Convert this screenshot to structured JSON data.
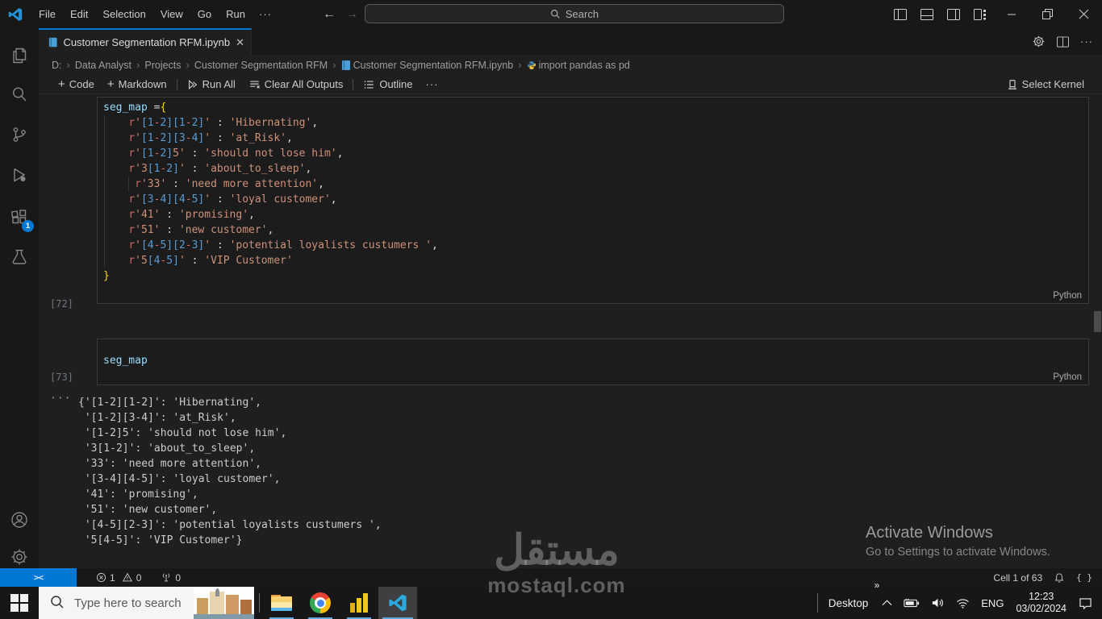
{
  "icons": {
    "ellipsis": "···",
    "back": "←",
    "forward": "→",
    "search_glyph": "⌕",
    "chevron": "›",
    "close": "✕",
    "plus": "+",
    "guillemet": "»",
    "remote": "><",
    "braces": "{ }"
  },
  "titlebar": {
    "menus": [
      "File",
      "Edit",
      "Selection",
      "View",
      "Go",
      "Run"
    ],
    "search_placeholder": "Search"
  },
  "tab": {
    "title": "Customer Segmentation RFM.ipynb"
  },
  "breadcrumbs": {
    "items": [
      "D:",
      "Data Analyst",
      "Projects",
      "Customer Segmentation RFM",
      "Customer Segmentation RFM.ipynb",
      "import pandas as pd"
    ]
  },
  "notebook_toolbar": {
    "code": "Code",
    "markdown": "Markdown",
    "run_all": "Run All",
    "clear_all": "Clear All Outputs",
    "outline": "Outline",
    "select_kernel": "Select Kernel"
  },
  "cells": [
    {
      "execution_count": "[72]",
      "language": "Python",
      "lines": [
        [
          [
            "k",
            "seg_map"
          ],
          [
            "d",
            " ="
          ],
          [
            "y",
            "{"
          ]
        ],
        [
          [
            "d",
            "    "
          ],
          [
            "r",
            "r"
          ],
          [
            "s",
            "'"
          ],
          [
            "c",
            "[1"
          ],
          [
            "r",
            "-"
          ],
          [
            "c",
            "2]"
          ],
          [
            "c",
            "[1"
          ],
          [
            "r",
            "-"
          ],
          [
            "c",
            "2]"
          ],
          [
            "s",
            "'"
          ],
          [
            "d",
            " : "
          ],
          [
            "s",
            "'Hibernating'"
          ],
          [
            "d",
            ","
          ]
        ],
        [
          [
            "d",
            "    "
          ],
          [
            "r",
            "r"
          ],
          [
            "s",
            "'"
          ],
          [
            "c",
            "[1"
          ],
          [
            "r",
            "-"
          ],
          [
            "c",
            "2]"
          ],
          [
            "c",
            "[3"
          ],
          [
            "r",
            "-"
          ],
          [
            "c",
            "4]"
          ],
          [
            "s",
            "'"
          ],
          [
            "d",
            " : "
          ],
          [
            "s",
            "'at_Risk'"
          ],
          [
            "d",
            ","
          ]
        ],
        [
          [
            "d",
            "    "
          ],
          [
            "r",
            "r"
          ],
          [
            "s",
            "'"
          ],
          [
            "c",
            "[1"
          ],
          [
            "r",
            "-"
          ],
          [
            "c",
            "2]"
          ],
          [
            "s",
            "5'"
          ],
          [
            "d",
            " : "
          ],
          [
            "s",
            "'should not lose him'"
          ],
          [
            "d",
            ","
          ]
        ],
        [
          [
            "d",
            "    "
          ],
          [
            "r",
            "r"
          ],
          [
            "s",
            "'3"
          ],
          [
            "c",
            "[1"
          ],
          [
            "r",
            "-"
          ],
          [
            "c",
            "2]"
          ],
          [
            "s",
            "'"
          ],
          [
            "d",
            " : "
          ],
          [
            "s",
            "'about_to_sleep'"
          ],
          [
            "d",
            ","
          ]
        ],
        [
          [
            "d",
            "     "
          ],
          [
            "r",
            "r"
          ],
          [
            "s",
            "'33'"
          ],
          [
            "d",
            " : "
          ],
          [
            "s",
            "'need more attention'"
          ],
          [
            "d",
            ","
          ]
        ],
        [
          [
            "d",
            "    "
          ],
          [
            "r",
            "r"
          ],
          [
            "s",
            "'"
          ],
          [
            "c",
            "[3"
          ],
          [
            "r",
            "-"
          ],
          [
            "c",
            "4]"
          ],
          [
            "c",
            "[4"
          ],
          [
            "r",
            "-"
          ],
          [
            "c",
            "5]"
          ],
          [
            "s",
            "'"
          ],
          [
            "d",
            " : "
          ],
          [
            "s",
            "'loyal customer'"
          ],
          [
            "d",
            ","
          ]
        ],
        [
          [
            "d",
            "    "
          ],
          [
            "r",
            "r"
          ],
          [
            "s",
            "'41'"
          ],
          [
            "d",
            " : "
          ],
          [
            "s",
            "'promising'"
          ],
          [
            "d",
            ","
          ]
        ],
        [
          [
            "d",
            "    "
          ],
          [
            "r",
            "r"
          ],
          [
            "s",
            "'51'"
          ],
          [
            "d",
            " : "
          ],
          [
            "s",
            "'new customer'"
          ],
          [
            "d",
            ","
          ]
        ],
        [
          [
            "d",
            "    "
          ],
          [
            "r",
            "r"
          ],
          [
            "s",
            "'"
          ],
          [
            "c",
            "[4"
          ],
          [
            "r",
            "-"
          ],
          [
            "c",
            "5]"
          ],
          [
            "c",
            "[2"
          ],
          [
            "r",
            "-"
          ],
          [
            "c",
            "3]"
          ],
          [
            "s",
            "'"
          ],
          [
            "d",
            " : "
          ],
          [
            "s",
            "'potential loyalists custumers '"
          ],
          [
            "d",
            ","
          ]
        ],
        [
          [
            "d",
            "    "
          ],
          [
            "r",
            "r"
          ],
          [
            "s",
            "'5"
          ],
          [
            "c",
            "[4"
          ],
          [
            "r",
            "-"
          ],
          [
            "c",
            "5]"
          ],
          [
            "s",
            "'"
          ],
          [
            "d",
            " : "
          ],
          [
            "s",
            "'VIP Customer'"
          ]
        ],
        [
          [
            "y",
            "}"
          ]
        ]
      ]
    },
    {
      "execution_count": "[73]",
      "language": "Python",
      "lines": [
        [
          [
            "k",
            "seg_map"
          ]
        ]
      ]
    }
  ],
  "output": {
    "gutter": "···",
    "lines": [
      "{'[1-2][1-2]': 'Hibernating',",
      " '[1-2][3-4]': 'at_Risk',",
      " '[1-2]5': 'should not lose him',",
      " '3[1-2]': 'about_to_sleep',",
      " '33': 'need more attention',",
      " '[3-4][4-5]': 'loyal customer',",
      " '41': 'promising',",
      " '51': 'new customer',",
      " '[4-5][2-3]': 'potential loyalists custumers ',",
      " '5[4-5]': 'VIP Customer'}"
    ]
  },
  "activitybar": {
    "extensions_badge": "1"
  },
  "statusbar": {
    "errors": "1",
    "warnings": "0",
    "ports": "0",
    "cell_indicator": "Cell 1 of 63"
  },
  "taskbar": {
    "search_placeholder": "Type here to search",
    "desktop_label": "Desktop",
    "language": "ENG",
    "time": "12:23",
    "date": "03/02/2024"
  },
  "watermarks": {
    "activate_title": "Activate Windows",
    "activate_subtitle": "Go to Settings to activate Windows.",
    "brand_arabic": "مستقل",
    "brand_domain": "mostaql.com"
  }
}
